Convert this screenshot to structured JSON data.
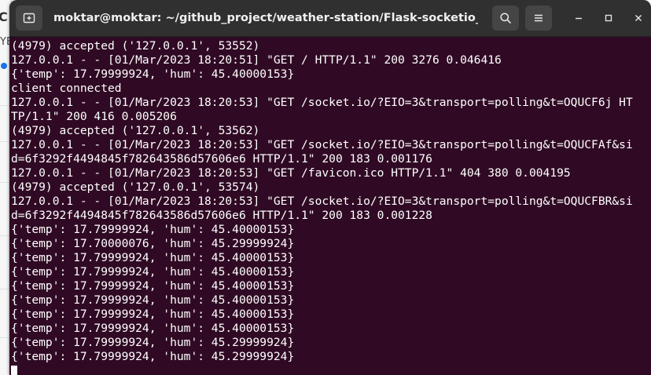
{
  "window": {
    "title": "moktar@moktar: ~/github_project/weather-station/Flask-socketio_server"
  },
  "titlebar_buttons": {
    "new_tab_icon": "new-tab-icon",
    "search_icon": "search-icon",
    "menu_icon": "hamburger-menu-icon",
    "minimize_icon": "minimize-icon",
    "maximize_icon": "maximize-icon",
    "close_icon": "close-icon"
  },
  "background_app": {
    "letter": "C",
    "fragment": "YE"
  },
  "colors": {
    "terminal_bg": "#300a24",
    "titlebar_bg": "#303030",
    "text": "#ffffff"
  },
  "terminal": {
    "lines": [
      "(4979) accepted ('127.0.0.1', 53552)",
      "127.0.0.1 - - [01/Mar/2023 18:20:51] \"GET / HTTP/1.1\" 200 3276 0.046416",
      "{'temp': 17.79999924, 'hum': 45.40000153}",
      "client connected",
      "127.0.0.1 - - [01/Mar/2023 18:20:53] \"GET /socket.io/?EIO=3&transport=polling&t=OQUCF6j HT",
      "TP/1.1\" 200 416 0.005206",
      "(4979) accepted ('127.0.0.1', 53562)",
      "127.0.0.1 - - [01/Mar/2023 18:20:53] \"GET /socket.io/?EIO=3&transport=polling&t=OQUCFAf&si",
      "d=6f3292f4494845f782643586d57606e6 HTTP/1.1\" 200 183 0.001176",
      "127.0.0.1 - - [01/Mar/2023 18:20:53] \"GET /favicon.ico HTTP/1.1\" 404 380 0.004195",
      "(4979) accepted ('127.0.0.1', 53574)",
      "127.0.0.1 - - [01/Mar/2023 18:20:53] \"GET /socket.io/?EIO=3&transport=polling&t=OQUCFBR&si",
      "d=6f3292f4494845f782643586d57606e6 HTTP/1.1\" 200 183 0.001228",
      "{'temp': 17.79999924, 'hum': 45.40000153}",
      "{'temp': 17.70000076, 'hum': 45.29999924}",
      "{'temp': 17.79999924, 'hum': 45.40000153}",
      "{'temp': 17.79999924, 'hum': 45.40000153}",
      "{'temp': 17.79999924, 'hum': 45.40000153}",
      "{'temp': 17.79999924, 'hum': 45.40000153}",
      "{'temp': 17.79999924, 'hum': 45.40000153}",
      "{'temp': 17.79999924, 'hum': 45.40000153}",
      "{'temp': 17.79999924, 'hum': 45.29999924}",
      "{'temp': 17.79999924, 'hum': 45.29999924}"
    ]
  }
}
